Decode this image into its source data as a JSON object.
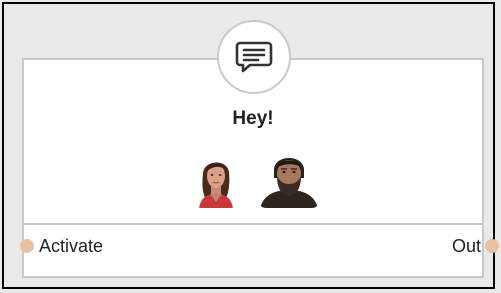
{
  "node": {
    "title": "Hey!",
    "icon": "speech-bubble-icon",
    "participants": [
      {
        "avatar": "female-character-avatar"
      },
      {
        "avatar": "bearded-man-avatar"
      }
    ],
    "pins": {
      "input": {
        "label": "Activate"
      },
      "output": {
        "label": "Out"
      }
    }
  },
  "colors": {
    "canvas": "#e9e9e9",
    "card": "#ffffff",
    "border": "#c9c9c9",
    "pin": "#e8c2a4"
  }
}
